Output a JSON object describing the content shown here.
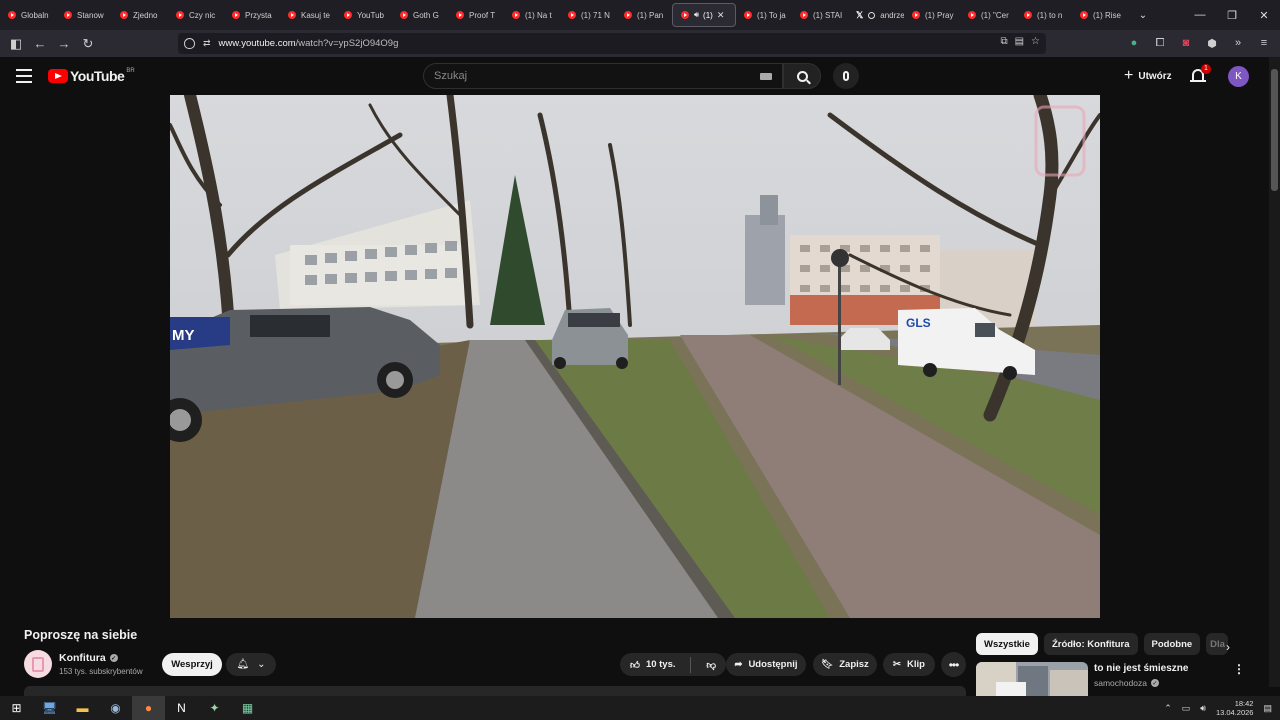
{
  "browser": {
    "tabs": [
      {
        "label": "Globaln",
        "icon": "youtube-icon"
      },
      {
        "label": "Stanow",
        "icon": "youtube-icon"
      },
      {
        "label": "Zjedno",
        "icon": "youtube-icon"
      },
      {
        "label": "Czy nic",
        "icon": "youtube-icon"
      },
      {
        "label": "Przysta",
        "icon": "youtube-icon"
      },
      {
        "label": "Kasuj te",
        "icon": "youtube-icon"
      },
      {
        "label": "YouTub",
        "icon": "youtube-icon"
      },
      {
        "label": "Goth G",
        "icon": "youtube-icon"
      },
      {
        "label": "Proof T",
        "icon": "youtube-icon"
      },
      {
        "label": "(1) Na t",
        "icon": "youtube-icon"
      },
      {
        "label": "(1) 71 N",
        "icon": "youtube-icon"
      },
      {
        "label": "(1) Pan",
        "icon": "youtube-icon"
      },
      {
        "label": "(1) ",
        "icon": "youtube-icon",
        "active": true
      },
      {
        "label": "(1) To ja",
        "icon": "youtube-icon"
      },
      {
        "label": "(1) STAI",
        "icon": "youtube-icon"
      },
      {
        "label": "andrze",
        "icon": "x-icon"
      },
      {
        "label": "(1) Pray",
        "icon": "youtube-icon"
      },
      {
        "label": "(1) \"Cer",
        "icon": "youtube-icon"
      },
      {
        "label": "(1) to n",
        "icon": "youtube-icon"
      },
      {
        "label": "(1) Rise",
        "icon": "youtube-icon"
      }
    ],
    "url_host": "www.youtube.com",
    "url_path": "/watch?v=ypS2jO94O9g"
  },
  "youtube": {
    "logo_text": "YouTube",
    "region": "BR",
    "search_placeholder": "Szukaj",
    "create_label": "Utwórz",
    "notification_count": "1",
    "avatar_letter": "K"
  },
  "video": {
    "title": "Poproszę na siebie",
    "channel_name": "Konfitura",
    "subscribers": "153 tys. subskrybentów",
    "support_label": "Wesprzyj",
    "likes": "10 tys.",
    "share_label": "Udostępnij",
    "save_label": "Zapisz",
    "clip_label": "Klip",
    "scene": {
      "van_text": "GLS",
      "banner_text": "MY"
    }
  },
  "sidebar": {
    "chips": [
      "Wszystkie",
      "Źródło: Konfitura",
      "Podobne",
      "Dla"
    ],
    "rec_title": "to nie jest śmieszne",
    "rec_channel": "samochodoza"
  },
  "taskbar": {
    "time": "18:42",
    "date": "13.04.2026"
  },
  "colors": {
    "accent": "#ff0000",
    "bg": "#0f0f0f",
    "avatar": "#7e57c2"
  }
}
